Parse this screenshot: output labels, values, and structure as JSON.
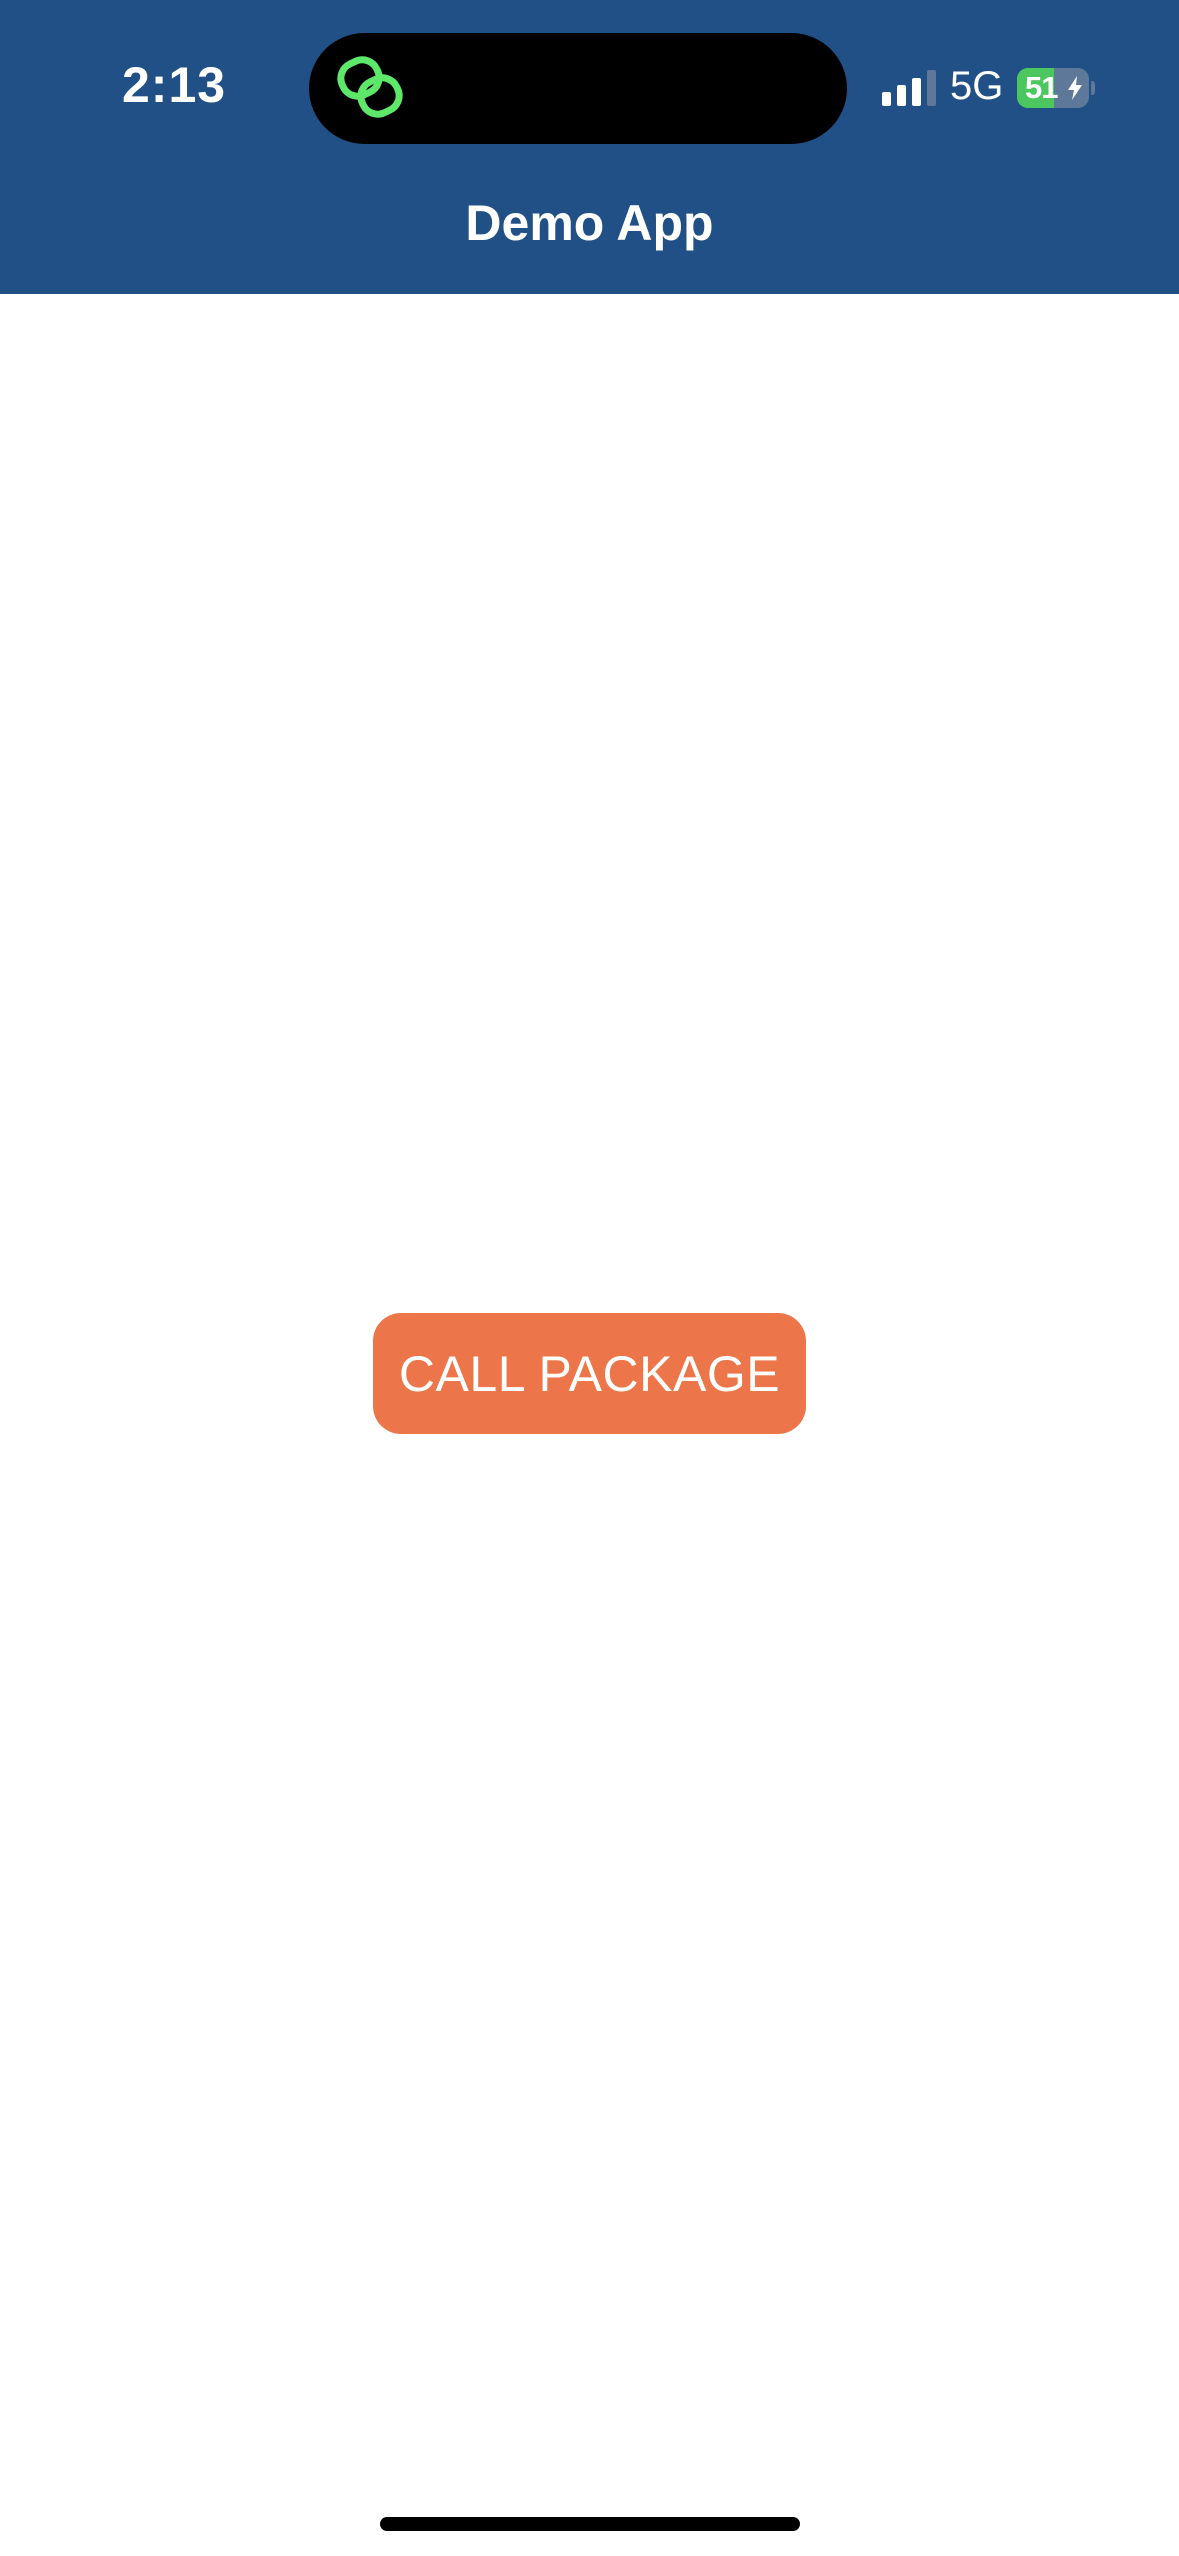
{
  "status_bar": {
    "time": "2:13",
    "network": "5G",
    "battery_level": "51",
    "battery_fraction": 0.51,
    "charging": true,
    "signal_icon": "signal-bars-icon",
    "island_activity_icon": "linked-rings-icon"
  },
  "header": {
    "title": "Demo App"
  },
  "main": {
    "call_button_label": "CALL PACKAGE"
  },
  "colors": {
    "header_bg": "#215087",
    "button_bg": "#ec754a",
    "island_icon": "#5ee86a",
    "battery_fill": "#4cc760"
  }
}
